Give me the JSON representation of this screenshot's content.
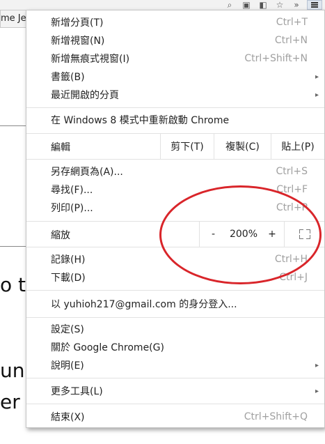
{
  "browser": {
    "tab_fragment": "me Jer"
  },
  "background_page": {
    "text_lines": [
      "o te",
      "uni",
      "er a"
    ]
  },
  "menu": {
    "items_group1": [
      {
        "label": "新增分頁(T)",
        "shortcut": "Ctrl+T"
      },
      {
        "label": "新增視窗(N)",
        "shortcut": "Ctrl+N"
      },
      {
        "label": "新增無痕式視窗(I)",
        "shortcut": "Ctrl+Shift+N"
      },
      {
        "label": "書籤(B)",
        "submenu": true
      },
      {
        "label": "最近開啟的分頁",
        "submenu": true
      }
    ],
    "relaunch_label": "在 Windows 8 模式中重新啟動 Chrome",
    "edit": {
      "label": "編輯",
      "cut": "剪下(T)",
      "copy": "複製(C)",
      "paste": "貼上(P)"
    },
    "items_group2": [
      {
        "label": "另存網頁為(A)...",
        "shortcut": "Ctrl+S"
      },
      {
        "label": "尋找(F)...",
        "shortcut": "Ctrl+F"
      },
      {
        "label": "列印(P)...",
        "shortcut": "Ctrl+P"
      }
    ],
    "zoom": {
      "label": "縮放",
      "minus": "-",
      "value": "200%",
      "plus": "+"
    },
    "items_group3": [
      {
        "label": "記錄(H)",
        "shortcut": "Ctrl+H"
      },
      {
        "label": "下載(D)",
        "shortcut": "Ctrl+J"
      }
    ],
    "signin_label": "以 yuhioh217@gmail.com 的身分登入...",
    "items_group4": [
      {
        "label": "設定(S)"
      },
      {
        "label": "關於 Google Chrome(G)"
      },
      {
        "label": "說明(E)",
        "submenu": true
      }
    ],
    "more_tools": {
      "label": "更多工具(L)",
      "submenu": true
    },
    "exit": {
      "label": "結束(X)",
      "shortcut": "Ctrl+Shift+Q"
    }
  },
  "icons": {
    "arrow": "▸",
    "search": "🔍",
    "star": "☆",
    "overflow": "»"
  },
  "colors": {
    "annotation": "#d9252a",
    "shortcut_text": "#a0a0a0"
  }
}
